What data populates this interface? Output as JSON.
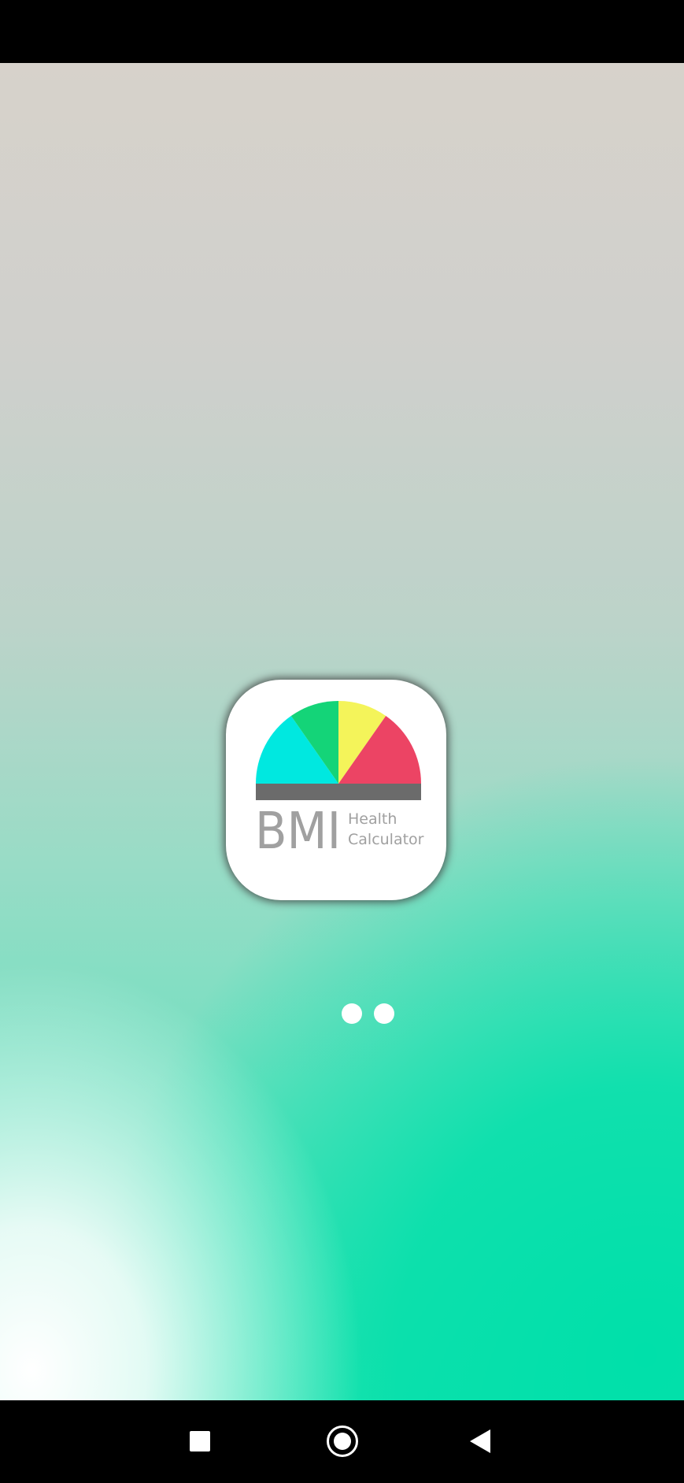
{
  "app_icon": {
    "name": "bmi-health-calculator-icon",
    "logo_text": "BMI",
    "tagline_line1": "Health",
    "tagline_line2": "Calculator",
    "gauge_colors": [
      "#00e8e0",
      "#14d478",
      "#f4f45a",
      "#ec4464"
    ],
    "bar_color": "#6b6b6b",
    "text_color": "#a0a0a0"
  },
  "splash": {
    "loading_indicator": "loading-dots",
    "dot_count": 2,
    "accent_color": "#00e0aa"
  },
  "nav_bar": {
    "recent_icon": "square-recents-icon",
    "home_icon": "circle-home-icon",
    "back_icon": "triangle-back-icon"
  }
}
